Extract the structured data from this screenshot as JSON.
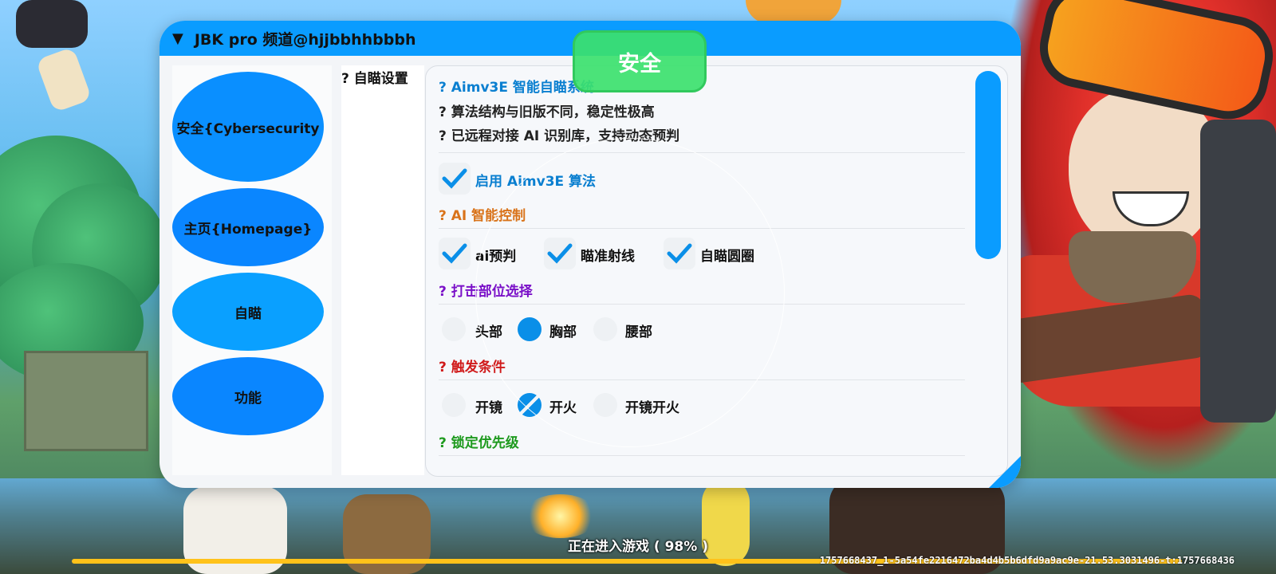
{
  "window": {
    "title": "JBK pro 频道@hjjbbhhbbbh",
    "collapse_arrow": "▼"
  },
  "status_badge": "安全",
  "sidebar": {
    "items": [
      {
        "label": "安全{Cybersecurity",
        "color": "#0a8fff"
      },
      {
        "label": "主页{Homepage}",
        "color": "#0a86ff"
      },
      {
        "label": "自瞄",
        "color": "#0aa0ff"
      },
      {
        "label": "功能",
        "color": "#0a86ff"
      }
    ]
  },
  "section_tab": "? 自瞄设置",
  "content": {
    "header": {
      "title": "? Aimv3E 智能自瞄系统",
      "desc1": "? 算法结构与旧版不同，稳定性极高",
      "desc2": "? 已远程对接 AI 识别库，支持动态预判"
    },
    "enable_checkbox": {
      "label": "启用 Aimv3E 算法",
      "checked": true
    },
    "ai_section": {
      "title": "? AI 智能控制",
      "color": "#d9731a"
    },
    "ai_options": [
      {
        "label": "ai预判",
        "checked": true
      },
      {
        "label": "瞄准射线",
        "checked": true
      },
      {
        "label": "自瞄圆圈",
        "checked": true
      }
    ],
    "hit_section": {
      "title": "? 打击部位选择",
      "color": "#7a10c8"
    },
    "hit_options": [
      {
        "label": "头部",
        "selected": false
      },
      {
        "label": "胸部",
        "selected": true
      },
      {
        "label": "腰部",
        "selected": false
      }
    ],
    "trigger_section": {
      "title": "? 触发条件",
      "color": "#d01a1a"
    },
    "trigger_options": [
      {
        "label": "开镜",
        "selected": false
      },
      {
        "label": "开火",
        "selected": true
      },
      {
        "label": "开镜开火",
        "selected": false
      }
    ],
    "lock_section": {
      "title": "? 锁定优先级",
      "color": "#1e9a1e"
    }
  },
  "loading": {
    "text": "正在进入游戏 ( 98% )",
    "progress": 0.98,
    "build_id": "1757668437_1-5a54fe2216472ba4d4b5b6dfd9a9ac9e-21.53.3031496-t:1757668436"
  },
  "colors": {
    "accent": "#0a9cff",
    "checkmark": "#0a8fe8",
    "header_title": "#0a7fd0",
    "status_badge": "#3ce16e"
  }
}
